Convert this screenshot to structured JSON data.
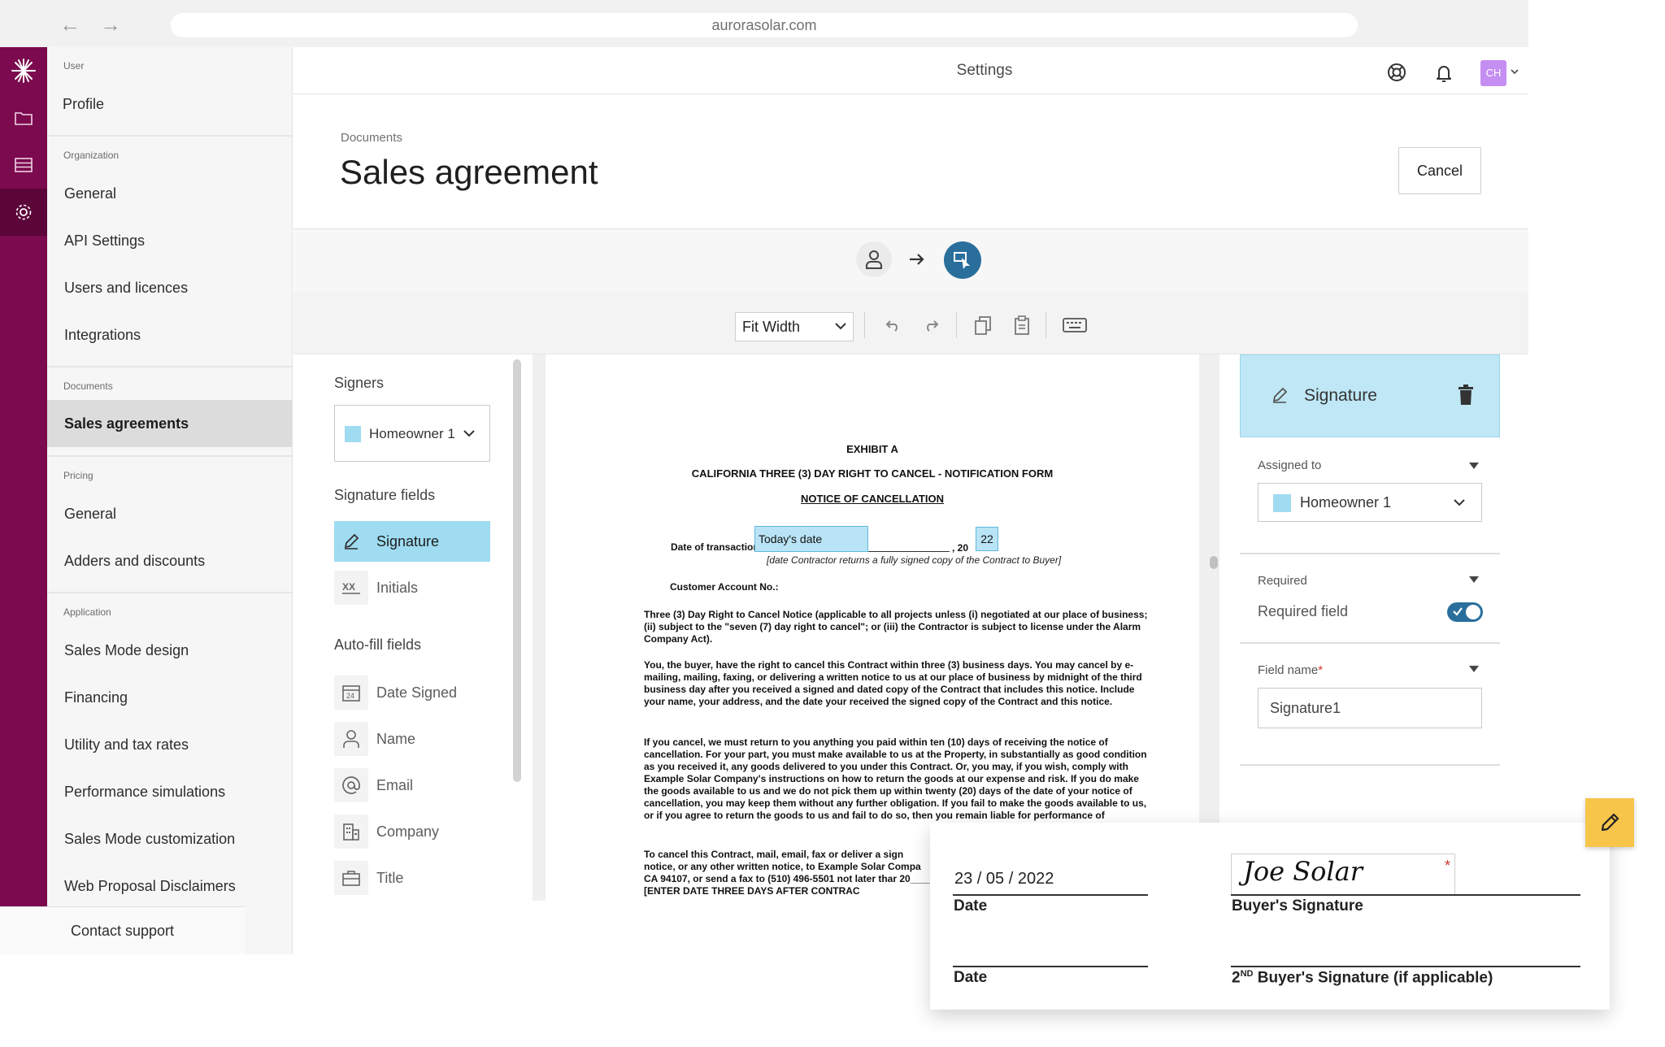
{
  "browser": {
    "url": "aurorasolar.com"
  },
  "topbar": {
    "title": "Settings",
    "avatar_initials": "CH"
  },
  "sidebar": {
    "sections": [
      {
        "heading": "User",
        "items": [
          "Profile"
        ]
      },
      {
        "heading": "Organization",
        "items": [
          "General",
          "API Settings",
          "Users and licences",
          "Integrations"
        ]
      },
      {
        "heading": "Documents",
        "items": [
          "Sales agreements"
        ]
      },
      {
        "heading": "Pricing",
        "items": [
          "General",
          "Adders and discounts"
        ]
      },
      {
        "heading": "Application",
        "items": [
          "Sales Mode design",
          "Financing",
          "Utility and tax rates",
          "Performance simulations",
          "Sales Mode customization",
          "Web Proposal Disclaimers"
        ]
      }
    ],
    "selected": "Sales agreements",
    "contact_support": "Contact support"
  },
  "header": {
    "breadcrumb": "Documents",
    "title": "Sales agreement",
    "cancel_label": "Cancel"
  },
  "toolbar": {
    "zoom": "Fit Width"
  },
  "left_panel": {
    "signers_heading": "Signers",
    "signer_selected": "Homeowner 1",
    "signer_color": "#9fdcf1",
    "signature_fields_heading": "Signature fields",
    "signature_fields": [
      {
        "label": "Signature",
        "icon": "pen-icon",
        "selected": true
      },
      {
        "label": "Initials",
        "icon": "initials-icon",
        "selected": false
      }
    ],
    "autofill_heading": "Auto-fill fields",
    "autofill_fields": [
      {
        "label": "Date Signed",
        "icon": "calendar-icon"
      },
      {
        "label": "Name",
        "icon": "person-icon"
      },
      {
        "label": "Email",
        "icon": "at-icon"
      },
      {
        "label": "Company",
        "icon": "building-icon"
      },
      {
        "label": "Title",
        "icon": "briefcase-icon"
      }
    ]
  },
  "document": {
    "exhibit": "EXHIBIT A",
    "form_title": "CALIFORNIA THREE (3) DAY RIGHT TO CANCEL - NOTIFICATION FORM",
    "notice": "NOTICE OF CANCELLATION",
    "date_label": "Date of transaction",
    "date_field": "Today's date",
    "year_prefix": ", 20",
    "year_field": "22",
    "date_note": "[date Contractor returns a fully signed copy of the Contract to Buyer]",
    "account_label": "Customer Account No.:",
    "paragraphs": [
      "Three (3) Day Right to Cancel Notice (applicable to all projects unless (i) negotiated at our place of business; (ii) subject to the \"seven (7) day right to cancel\"; or (iii) the Contractor is subject to license under the Alarm Company Act).",
      "You, the buyer, have the right to cancel this Contract within three (3) business days.  You may cancel by e-mailing, mailing, faxing, or delivering a written notice to us at our place of business by midnight of the third business day after you received a signed and dated copy of the Contract that includes this notice.  Include your name, your address, and the date your received the signed copy of the Contract and this notice.",
      "If you cancel, we must return to you anything you paid within ten (10) days of receiving the notice of cancellation.  For your part, you must make available to us at the Property, in substantially as good condition as you received it, any goods delivered to you under this Contract.  Or, you may, if you wish, comply with Example Solar Company's instructions on how to return the goods at our expense and risk.  If you do make the goods available to us and we do not pick them up within twenty (20) days of the date of your notice of cancellation, you may keep them without any further obligation.  If you fail to make the goods available to us, or if you agree to return the goods to us and fail to do so, then you remain liable for performance of",
      "To cancel this Contract, mail, email, fax or deliver a sign notice, or any other written notice, to Example Solar Compa CA 94107, or send a fax to (510) 496-5501 not later thar 20____  [ENTER DATE THREE DAYS AFTER CONTRAC"
    ]
  },
  "right_panel": {
    "field_type": "Signature",
    "assigned_label": "Assigned to",
    "assigned_value": "Homeowner 1",
    "required_label": "Required",
    "required_toggle_label": "Required field",
    "required_on": true,
    "field_name_label": "Field name",
    "field_name_value": "Signature1",
    "accent_color": "#2a6f9c"
  },
  "signature_card": {
    "date_value": "23 / 05 / 2022",
    "date_label": "Date",
    "signature_value": "Joe Solar",
    "buyer_label": "Buyer's Signature",
    "date2_label": "Date",
    "buyer2_label_pre": "2",
    "buyer2_label_sup": "ND",
    "buyer2_label_post": " Buyer's Signature (if applicable)",
    "required_mark": "*"
  }
}
